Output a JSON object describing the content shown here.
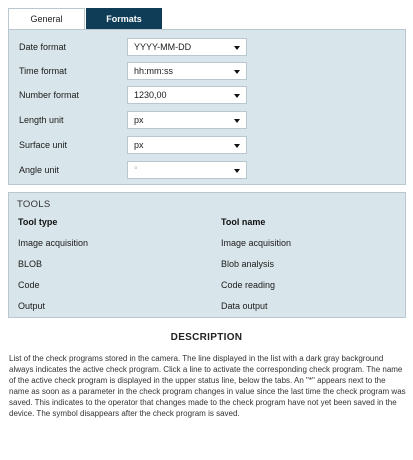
{
  "tabs": [
    {
      "label": "General",
      "active": false
    },
    {
      "label": "Formats",
      "active": true
    }
  ],
  "formats": {
    "rows": [
      {
        "label": "Date format",
        "value": "YYYY-MM-DD"
      },
      {
        "label": "Time format",
        "value": "hh:mm:ss"
      },
      {
        "label": "Number format",
        "value": "1230,00"
      },
      {
        "label": "Length unit",
        "value": "px"
      },
      {
        "label": "Surface unit",
        "value": "px"
      },
      {
        "label": "Angle unit",
        "value": "°"
      }
    ]
  },
  "tools": {
    "title": "TOOLS",
    "headers": {
      "type": "Tool type",
      "name": "Tool name"
    },
    "rows": [
      {
        "type": "Image acquisition",
        "name": "Image acquisition"
      },
      {
        "type": "BLOB",
        "name": "Blob analysis"
      },
      {
        "type": "Code",
        "name": "Code reading"
      },
      {
        "type": "Output",
        "name": "Data output"
      }
    ]
  },
  "description": {
    "title": "DESCRIPTION",
    "text": "List of the check programs stored in the camera. The line displayed in the list with a dark gray background always indicates the active check program. Click a line to activate the corresponding check program. The name of the active check program is displayed in the upper status line, below the tabs. An \"*\" appears next to the name as soon as a parameter in the check program changes in value since the last time the check program was saved. This indicates to the operator that changes made to the check program have not yet been saved in the device. The symbol disappears after the check program is saved."
  },
  "colors": {
    "active_tab": "#0f3d58",
    "panel_bg": "#d8e5ea",
    "border": "#b9c7cf"
  }
}
